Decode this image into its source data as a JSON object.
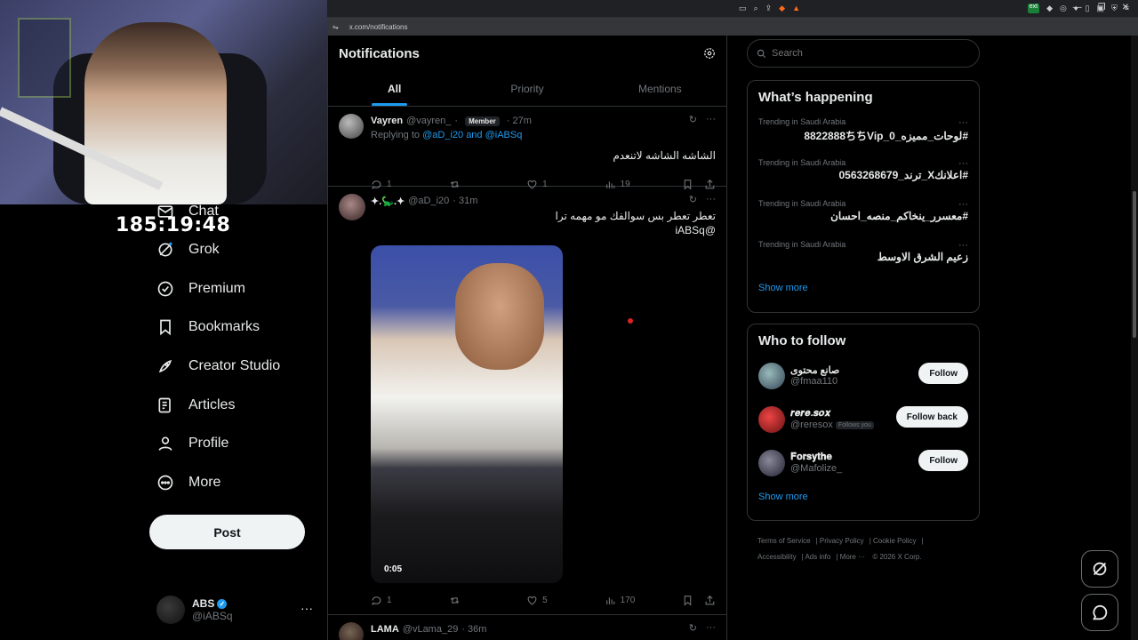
{
  "stream": {
    "timer": "185:19:48"
  },
  "browser": {
    "url": "x.com/notifications"
  },
  "nav": {
    "items": [
      {
        "label": "Chat",
        "icon": "chat-icon"
      },
      {
        "label": "Grok",
        "icon": "grok-icon"
      },
      {
        "label": "Premium",
        "icon": "premium-icon"
      },
      {
        "label": "Bookmarks",
        "icon": "bookmark-icon"
      },
      {
        "label": "Creator Studio",
        "icon": "rocket-icon"
      },
      {
        "label": "Articles",
        "icon": "articles-icon"
      },
      {
        "label": "Profile",
        "icon": "profile-icon"
      },
      {
        "label": "More",
        "icon": "more-icon"
      }
    ],
    "post_label": "Post",
    "account": {
      "name": "ABS",
      "handle": "@iABSq"
    }
  },
  "main": {
    "title": "Notifications",
    "tabs": [
      "All",
      "Priority",
      "Mentions"
    ],
    "tweets": [
      {
        "name": "Vayren",
        "handle": "@vayren_",
        "badge": "Member",
        "time": "· 27m",
        "reply_prefix": "Replying to",
        "reply_handles": "@aD_i20 and @iABSq",
        "text": "الشاشه الشاشه لاتنعدم",
        "replies": "1",
        "retweets": "",
        "likes": "1",
        "views": "19"
      },
      {
        "name": "✦.🦕.✦",
        "handle": "@aD_i20",
        "time": "· 31m",
        "text": "تعطر تعطر بس سوالفك مو مهمه ترا",
        "mention": "@iABSq",
        "video_duration": "0:05",
        "replies": "1",
        "retweets": "",
        "likes": "5",
        "views": "170"
      },
      {
        "name": "LAMA",
        "handle": "@vLama_29",
        "time": "· 36m"
      }
    ]
  },
  "right": {
    "search_placeholder": "Search",
    "trends_title": "What’s happening",
    "trends": [
      {
        "meta": "Trending in Saudi Arabia",
        "topic": "#لوحات_مميزه_8822888ちちVip_0"
      },
      {
        "meta": "Trending in Saudi Arabia",
        "topic": "#اعلانكX_ترند_0563268679"
      },
      {
        "meta": "Trending in Saudi Arabia",
        "topic": "#معسرر_ينخاكم_منصه_احسان"
      },
      {
        "meta": "Trending in Saudi Arabia",
        "topic": "زعيم الشرق الاوسط"
      }
    ],
    "show_more": "Show more",
    "wtf_title": "Who to follow",
    "follow": [
      {
        "name": "صانع محتوى",
        "handle": "@fmaa110",
        "button": "Follow",
        "follows_you": ""
      },
      {
        "name": "𝒓𝒆𝒓𝒆.𝒔𝒐𝒙",
        "handle": "@reresox",
        "button": "Follow back",
        "follows_you": "Follows you"
      },
      {
        "name": "𝐅𝐨𝐫𝐬𝐲𝐭𝐡𝐞",
        "handle": "@Mafolize_",
        "button": "Follow",
        "follows_you": ""
      }
    ],
    "footer": [
      "Terms of Service",
      "Privacy Policy",
      "Cookie Policy",
      "Accessibility",
      "Ads info",
      "More ···",
      "© 2026 X Corp."
    ]
  },
  "colors": {
    "accent": "#1d9bf0",
    "background": "#000000",
    "border": "#2f3336",
    "muted": "#71767b"
  }
}
